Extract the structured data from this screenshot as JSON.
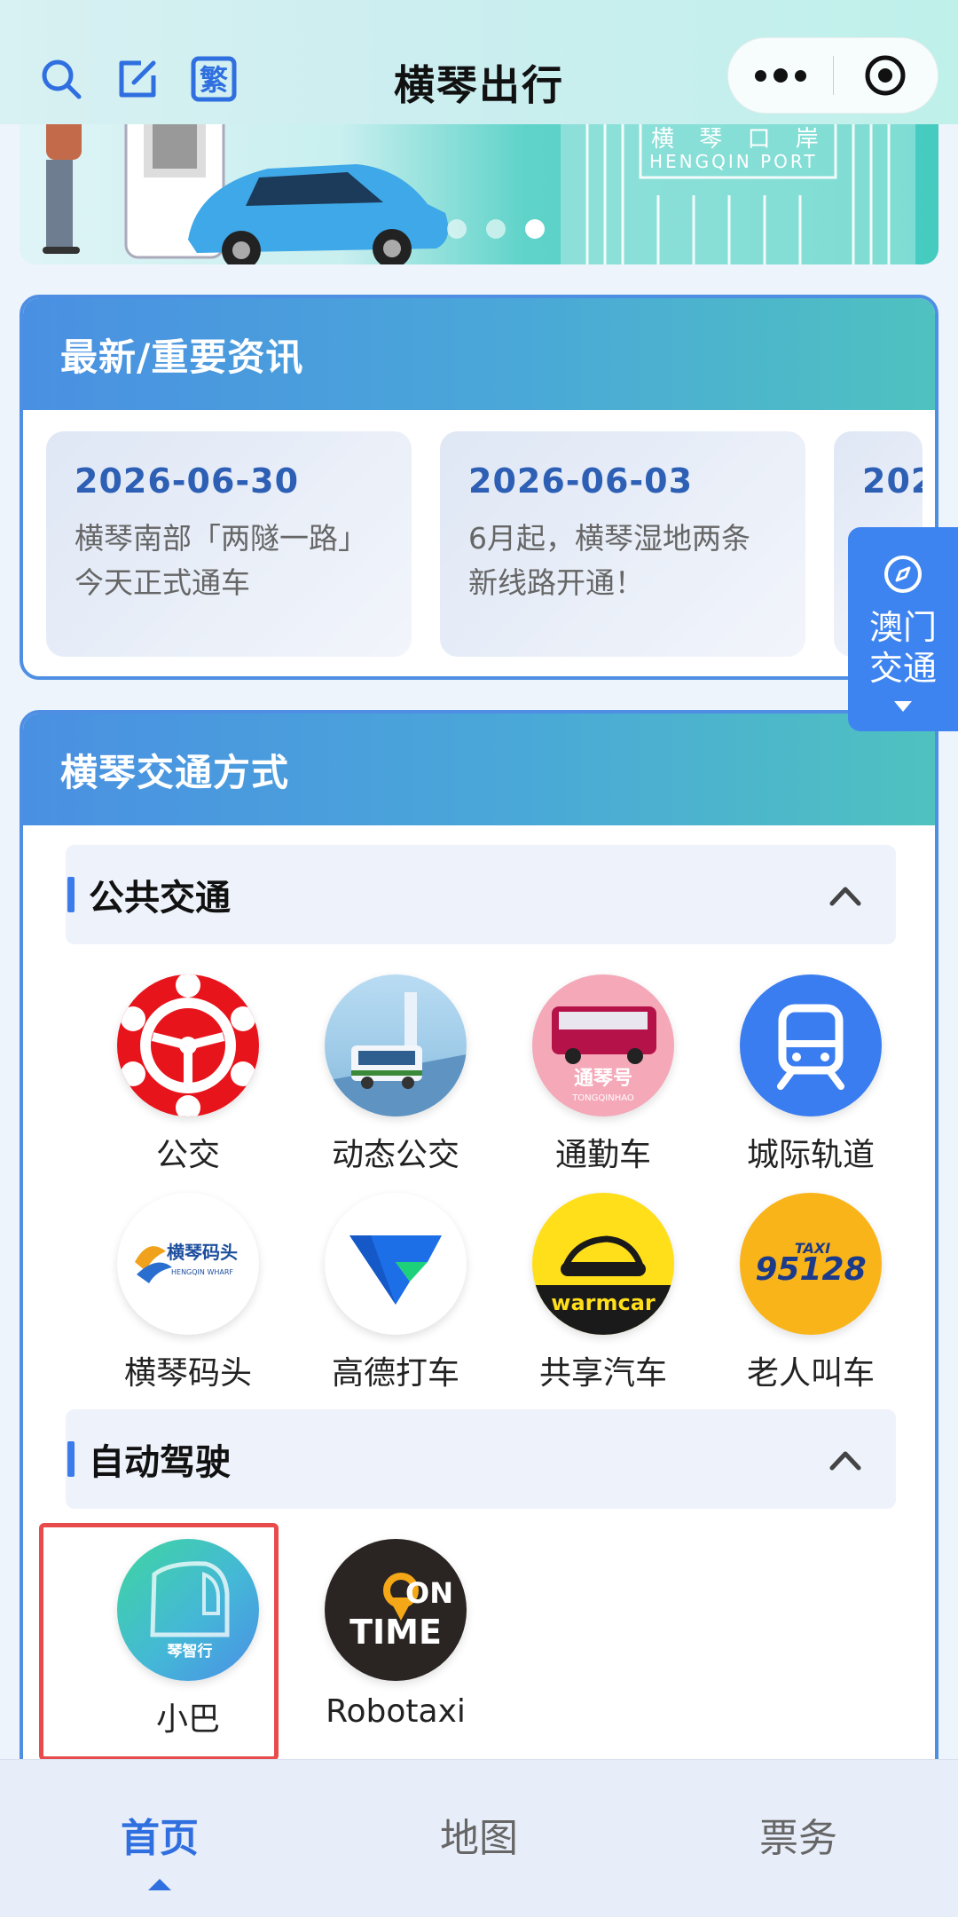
{
  "header": {
    "title": "横琴出行",
    "traditional_label": "繁"
  },
  "banner": {
    "port_name_cn": "横 琴 口 岸",
    "port_name_en": "HENGQIN PORT",
    "dots_count": 3,
    "active_dot": 2
  },
  "news": {
    "title": "最新/重要资讯",
    "items": [
      {
        "date": "2026-06-30",
        "text": "横琴南部「两隧一路」今天正式通车"
      },
      {
        "date": "2026-06-03",
        "text": "6月起，横琴湿地两条新线路开通！"
      },
      {
        "date": "202",
        "text": ""
      }
    ]
  },
  "macau_button": {
    "label_line1": "澳门",
    "label_line2": "交通"
  },
  "transport": {
    "title": "横琴交通方式",
    "public": {
      "title": "公共交通",
      "items": [
        {
          "label": "公交",
          "icon": "bus-wheel-icon"
        },
        {
          "label": "动态公交",
          "icon": "dynamic-bus-icon"
        },
        {
          "label": "通勤车",
          "icon": "commuter-bus-icon",
          "badge": "通琴号",
          "badge_en": "TONGQINHAO"
        },
        {
          "label": "城际轨道",
          "icon": "train-icon"
        },
        {
          "label": "横琴码头",
          "icon": "pier-icon",
          "badge": "横琴码头",
          "badge_en": "HENGQIN WHARF"
        },
        {
          "label": "高德打车",
          "icon": "amap-icon"
        },
        {
          "label": "共享汽车",
          "icon": "warmcar-icon",
          "badge": "warmcar"
        },
        {
          "label": "老人叫车",
          "icon": "taxi-95128-icon",
          "badge": "95128",
          "badge_top": "TAXI"
        }
      ]
    },
    "autonomous": {
      "title": "自动驾驶",
      "items": [
        {
          "label": "小巴",
          "icon": "minibus-icon",
          "badge": "琴智行"
        },
        {
          "label": "Robotaxi",
          "icon": "ontime-icon",
          "badge_line1": "ON",
          "badge_line2": "TIME"
        }
      ]
    }
  },
  "tabs": [
    {
      "label": "首页",
      "active": true
    },
    {
      "label": "地图",
      "active": false
    },
    {
      "label": "票务",
      "active": false
    }
  ],
  "colors": {
    "accent": "#3e84f0",
    "header_gradient_start": "#4a90e2",
    "header_gradient_end": "#4fc2c0",
    "highlight": "#e84b4b"
  }
}
